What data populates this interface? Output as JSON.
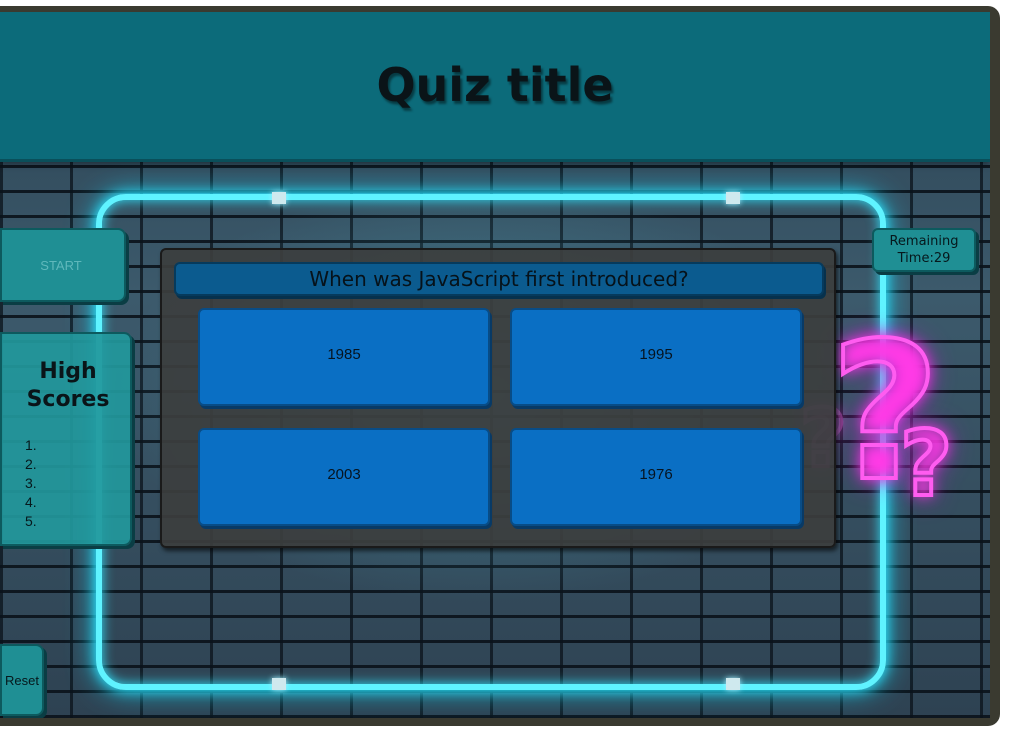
{
  "header": {
    "title": "Quiz title"
  },
  "controls": {
    "start_label": "START",
    "reset_label": "Reset"
  },
  "timer": {
    "line1": "Remaining",
    "line2": "Time:29"
  },
  "high_scores": {
    "title_line1": "High",
    "title_line2": "Scores",
    "entries": [
      "1.",
      "2.",
      "3.",
      "4.",
      "5."
    ]
  },
  "quiz": {
    "question": "When was JavaScript first introduced?",
    "answers": [
      "1985",
      "1995",
      "2003",
      "1976"
    ]
  },
  "colors": {
    "header_bg": "#0c6b7a",
    "panel_accent": "#1f8f94",
    "answer_bg": "#0a6fc4",
    "question_bg": "#0b5b8f",
    "neon_cyan": "#5ff3ff",
    "neon_pink": "#ff5cf0"
  },
  "icons": {
    "background_art": "neon-question-mark-icon"
  }
}
